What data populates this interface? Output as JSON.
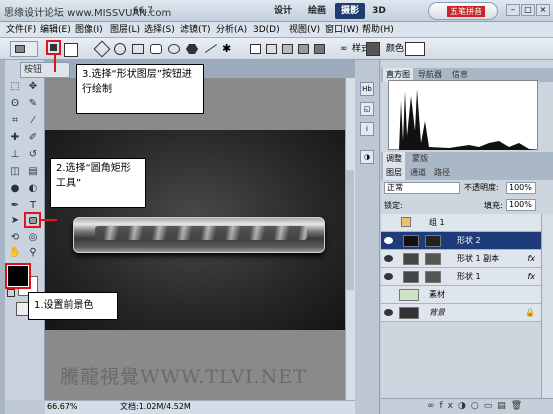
{
  "titlebar": {
    "watermark": "思缘设计论坛 www.MISSVUAN.com",
    "zoom": "66.7",
    "workspace": [
      "设计",
      "绘画",
      "摄影",
      "3D"
    ],
    "cs_live": "五笔拼音"
  },
  "menu": [
    "文件(F)",
    "编辑(E)",
    "图像(I)",
    "图层(L)",
    "选择(S)",
    "滤镜(T)",
    "分析(A)",
    "3D(D)",
    "视图(V)",
    "窗口(W)",
    "帮助(H)"
  ],
  "options": {
    "style_label": "样式:",
    "color_label": "颜色:"
  },
  "document": {
    "tab": "桉钮",
    "zoom": "66.67%",
    "doc_info": "文档:1.02M/4.52M",
    "watermark": "騰龍視覺WWW.TLVI.NET"
  },
  "callouts": {
    "step1": "1.设置前景色",
    "step2": "2.选择“圆角矩形工具”",
    "step3": "3.选择“形状图层”按钮进行绘制"
  },
  "panels": {
    "top_tabs": [
      "直方图",
      "导航器",
      "信息"
    ],
    "mid_tabs": [
      "调整",
      "蒙版"
    ],
    "layer_tabs": [
      "图层",
      "通道",
      "路径"
    ],
    "blend_mode": "正常",
    "opacity_label": "不透明度:",
    "opacity": "100%",
    "lock_label": "锁定:",
    "fill_label": "填充:",
    "fill": "100%",
    "layers": [
      {
        "name": "组 1",
        "type": "group"
      },
      {
        "name": "形状 2",
        "type": "shape",
        "selected": true
      },
      {
        "name": "形状 1 副本",
        "type": "shape",
        "fx": "fx"
      },
      {
        "name": "形状 1",
        "type": "shape",
        "fx": "fx"
      },
      {
        "name": "素材",
        "type": "pixel"
      },
      {
        "name": "背景",
        "type": "background"
      }
    ]
  }
}
